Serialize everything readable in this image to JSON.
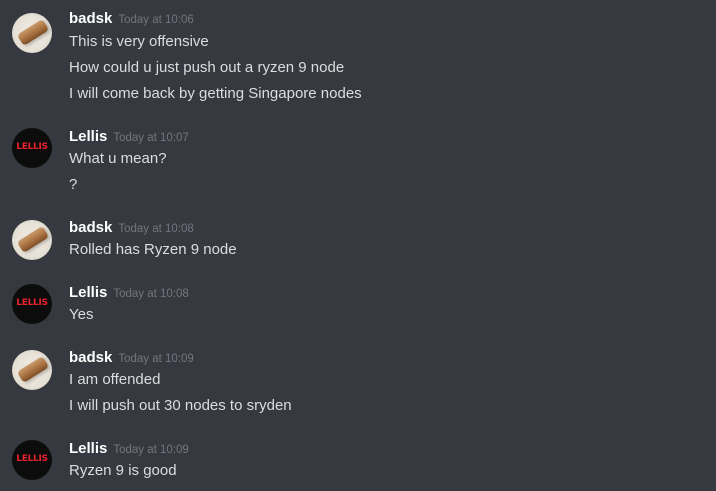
{
  "messages": [
    {
      "username": "badsk",
      "timestamp": "Today at 10:06",
      "avatar": "rusty-bar-avatar",
      "lines": [
        "This is very offensive",
        "How could u just push out a ryzen 9 node",
        "I will come back by getting Singapore nodes"
      ]
    },
    {
      "username": "Lellis",
      "timestamp": "Today at 10:07",
      "avatar": "lellis-logo-avatar",
      "avatar_text": "LELLIS",
      "lines": [
        "What u mean?",
        "?"
      ]
    },
    {
      "username": "badsk",
      "timestamp": "Today at 10:08",
      "avatar": "rusty-bar-avatar",
      "lines": [
        "Rolled has Ryzen 9 node"
      ]
    },
    {
      "username": "Lellis",
      "timestamp": "Today at 10:08",
      "avatar": "lellis-logo-avatar",
      "avatar_text": "LELLIS",
      "lines": [
        "Yes"
      ]
    },
    {
      "username": "badsk",
      "timestamp": "Today at 10:09",
      "avatar": "rusty-bar-avatar",
      "lines": [
        "I am offended",
        "I will push out 30 nodes to sryden"
      ]
    },
    {
      "username": "Lellis",
      "timestamp": "Today at 10:09",
      "avatar": "lellis-logo-avatar",
      "avatar_text": "LELLIS",
      "lines": [
        "Ryzen 9 is good"
      ]
    }
  ],
  "colors": {
    "background": "#36393f",
    "username": "#ffffff",
    "timestamp": "#72767d",
    "message_text": "#dcddde",
    "lellis_logo": "#e8232c"
  }
}
